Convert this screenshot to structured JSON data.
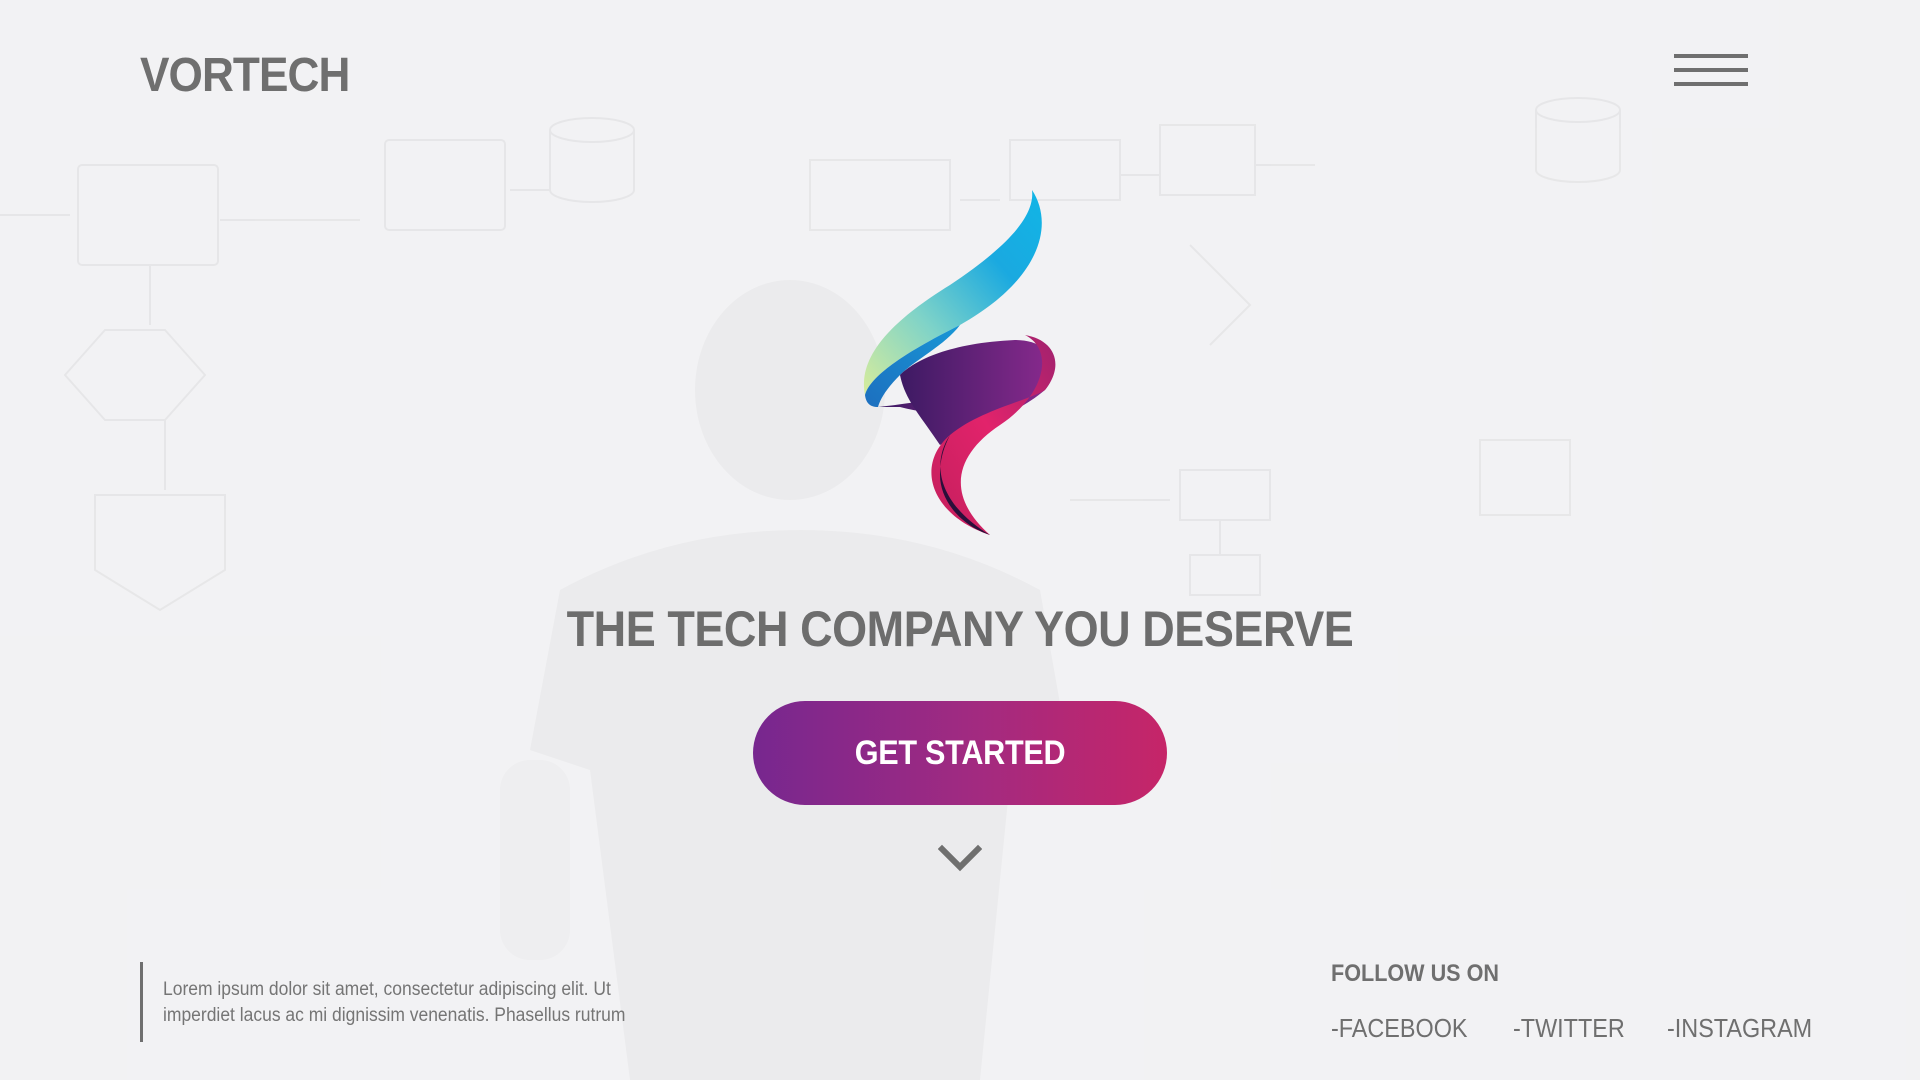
{
  "header": {
    "brand": "VORTECH",
    "menu_icon": "hamburger-menu-icon"
  },
  "hero": {
    "logo_icon": "ribbon-logo-icon",
    "headline": "THE TECH COMPANY YOU DESERVE",
    "cta_label": "GET STARTED",
    "scroll_icon": "chevron-down-icon"
  },
  "footer": {
    "about_text": "Lorem ipsum dolor sit amet, consectetur adipiscing elit. Ut imperdiet lacus ac mi dignissim venenatis. Phasellus rutrum",
    "follow_title": "FOLLOW US ON",
    "social_links": [
      "-FACEBOOK",
      "-TWITTER",
      "-INSTAGRAM"
    ]
  },
  "colors": {
    "text": "#6f6f6f",
    "cta_gradient_start": "#77278f",
    "cta_gradient_end": "#c62568",
    "logo_blue": "#1aa9e0",
    "logo_green": "#b9e3a0",
    "logo_purple": "#6a2a8e",
    "logo_pink": "#e2236b"
  }
}
